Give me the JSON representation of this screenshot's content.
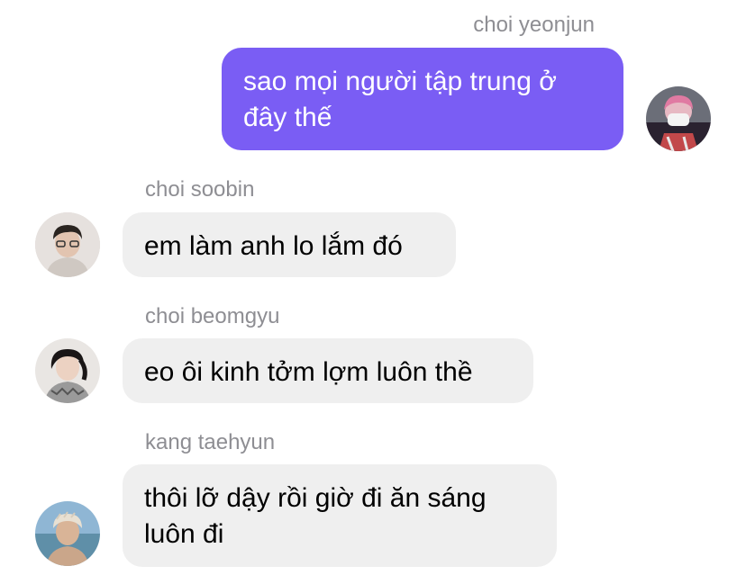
{
  "messages": [
    {
      "sender": "choi yeonjun",
      "text": "sao mọi người tập trung ở đây thế",
      "direction": "outgoing",
      "avatar_icon": "avatar-icon"
    },
    {
      "sender": "choi soobin",
      "text": "em làm anh lo lắm đó",
      "direction": "incoming",
      "avatar_icon": "avatar-icon"
    },
    {
      "sender": "choi beomgyu",
      "text": "eo ôi kinh tởm lợm luôn thề",
      "direction": "incoming",
      "avatar_icon": "avatar-icon"
    },
    {
      "sender": "kang taehyun",
      "text": "thôi lỡ dậy rồi giờ đi ăn sáng luôn đi",
      "direction": "incoming",
      "avatar_icon": "avatar-icon"
    }
  ],
  "colors": {
    "outgoing_bubble": "#7a5df4",
    "incoming_bubble": "#efefef",
    "sender_name": "#8e8e93"
  }
}
